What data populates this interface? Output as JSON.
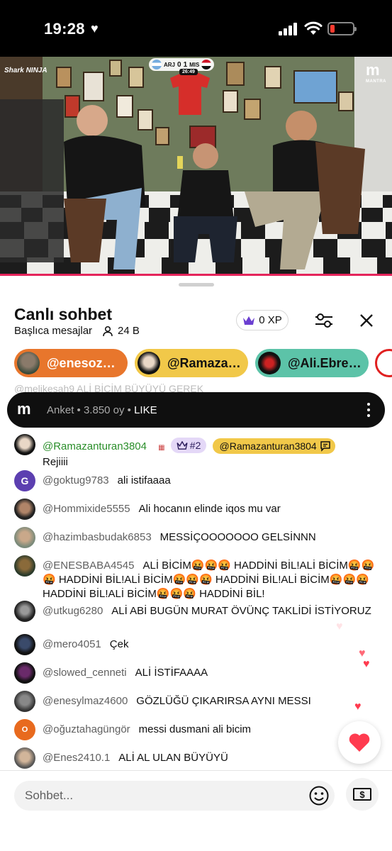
{
  "status_bar": {
    "time": "19:28"
  },
  "video": {
    "brand_left": "Shark NINJA",
    "brand_right": "MANTRA",
    "score": {
      "home": "ARJ",
      "home_goals": "0",
      "away_goals": "1",
      "away": "MIS",
      "clock": "26:49"
    },
    "progress_color": "#e5245b"
  },
  "chat": {
    "title": "Canlı sohbet",
    "mode": "Başlıca mesajlar",
    "viewers": "24 B",
    "xp": "0 XP",
    "chips": [
      {
        "label": "@enesoz…"
      },
      {
        "label": "@Ramaza…"
      },
      {
        "label": "@Ali.Ebre…"
      }
    ],
    "faded_row": "@melikesah9     ALİ BİCİM BÜYÜYÜ GEREK",
    "poll": {
      "logo": "m",
      "label": "Anket",
      "meta": " • 3.850 oy • ",
      "value": "LIKE"
    },
    "messages": [
      {
        "author": "@Ramazanturan3804",
        "rank": "#2",
        "reply_to": "@Ramazanturan3804",
        "text": "Rejiiii"
      },
      {
        "author": "@goktug9783",
        "text": "ali istifaaaa",
        "avatar_letter": "G"
      },
      {
        "author": "@Hommixide5555",
        "text": "Ali hocanın elinde iqos mu var"
      },
      {
        "author": "@hazimbasbudak6853",
        "text": "MESSİÇOOOOOOO GELSİNNN"
      },
      {
        "author": "@ENESBABA4545",
        "text": "ALİ BİCİM🤬🤬🤬 HADDİNİ BİL!ALİ BİCİM🤬🤬🤬 HADDİNİ BİL!ALİ BİCİM🤬🤬🤬 HADDİNİ BİL!ALİ BİCİM🤬🤬🤬 HADDİNİ BİL!ALİ BİCİM🤬🤬🤬 HADDİNİ BİL!"
      },
      {
        "author": "@utkug6280",
        "text": "ALİ ABİ BUGÜN MURAT ÖVÜNÇ TAKLİDİ İSTİYORUZ"
      },
      {
        "author": "@mero4051",
        "text": "Çek"
      },
      {
        "author": "@slowed_cenneti",
        "text": "ALİ İSTİFAAAA"
      },
      {
        "author": "@enesylmaz4600",
        "text": "GÖZLÜĞÜ ÇIKARIRSA AYNI MESSI"
      },
      {
        "author": "@oğuztahagüngör",
        "text": "messi dusmani ali bicim",
        "avatar_letter": "O"
      },
      {
        "author": "@Enes2410.1",
        "text": "ALİ AL ULAN BÜYÜYÜ"
      }
    ],
    "input_placeholder": "Sohbet..."
  },
  "colors": {
    "accent_red": "#e5245b",
    "heart": "#ff3b4f",
    "chip_orange": "#e8762c",
    "chip_yellow": "#f1c849",
    "chip_green": "#5cc3a8"
  }
}
